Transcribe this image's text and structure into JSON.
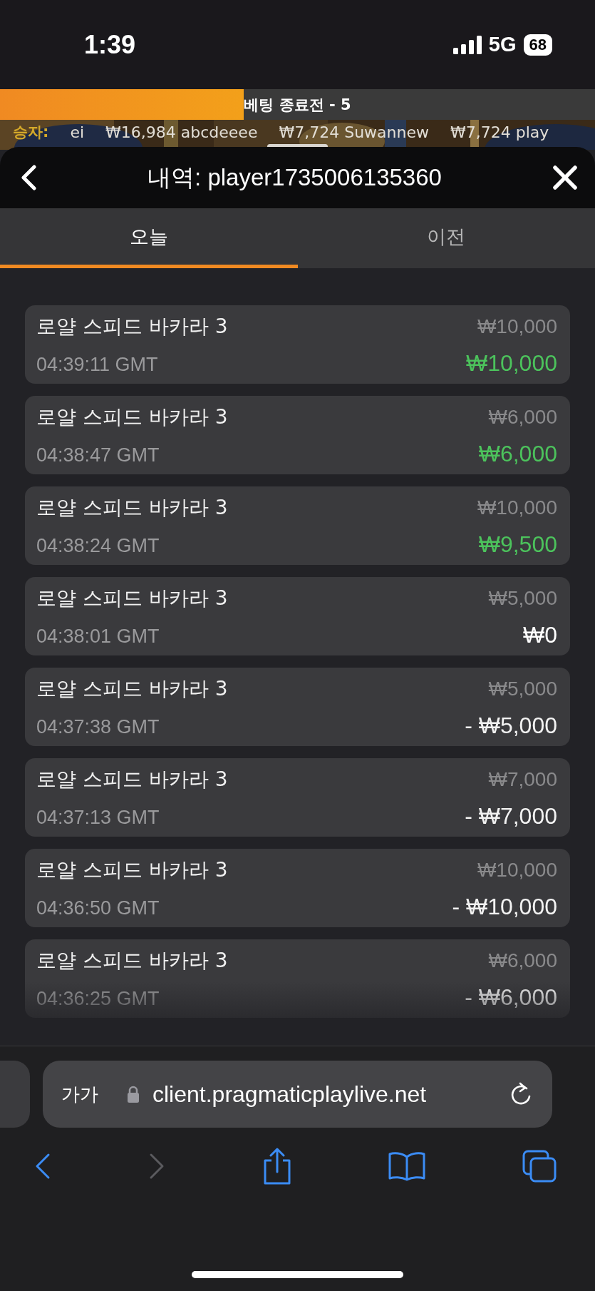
{
  "status_bar": {
    "time": "1:39",
    "network": "5G",
    "battery": "68"
  },
  "countdown": {
    "label": "베팅 종료전 - 5",
    "level": 0.41
  },
  "winners": {
    "label": "승자:",
    "entries": [
      "ei",
      "₩16,984 abcdeeee",
      "₩7,724 Suwannew",
      "₩7,724 play"
    ]
  },
  "header": {
    "title": "내역: player1735006135360"
  },
  "tabs": [
    {
      "label": "오늘",
      "selected": true
    },
    {
      "label": "이전",
      "selected": false
    }
  ],
  "history": [
    {
      "game": "로얄 스피드 바카라 3",
      "time": "04:39:11 GMT",
      "bet": "₩10,000",
      "result": "₩10,000",
      "kind": "win"
    },
    {
      "game": "로얄 스피드 바카라 3",
      "time": "04:38:47 GMT",
      "bet": "₩6,000",
      "result": "₩6,000",
      "kind": "win"
    },
    {
      "game": "로얄 스피드 바카라 3",
      "time": "04:38:24 GMT",
      "bet": "₩10,000",
      "result": "₩9,500",
      "kind": "win"
    },
    {
      "game": "로얄 스피드 바카라 3",
      "time": "04:38:01 GMT",
      "bet": "₩5,000",
      "result": "₩0",
      "kind": "even"
    },
    {
      "game": "로얄 스피드 바카라 3",
      "time": "04:37:38 GMT",
      "bet": "₩5,000",
      "result": "- ₩5,000",
      "kind": "loss"
    },
    {
      "game": "로얄 스피드 바카라 3",
      "time": "04:37:13 GMT",
      "bet": "₩7,000",
      "result": "- ₩7,000",
      "kind": "loss"
    },
    {
      "game": "로얄 스피드 바카라 3",
      "time": "04:36:50 GMT",
      "bet": "₩10,000",
      "result": "- ₩10,000",
      "kind": "loss"
    },
    {
      "game": "로얄 스피드 바카라 3",
      "time": "04:36:25 GMT",
      "bet": "₩6,000",
      "result": "- ₩6,000",
      "kind": "loss"
    }
  ],
  "browser": {
    "text_size": "가가",
    "url": "client.pragmaticplaylive.net"
  }
}
